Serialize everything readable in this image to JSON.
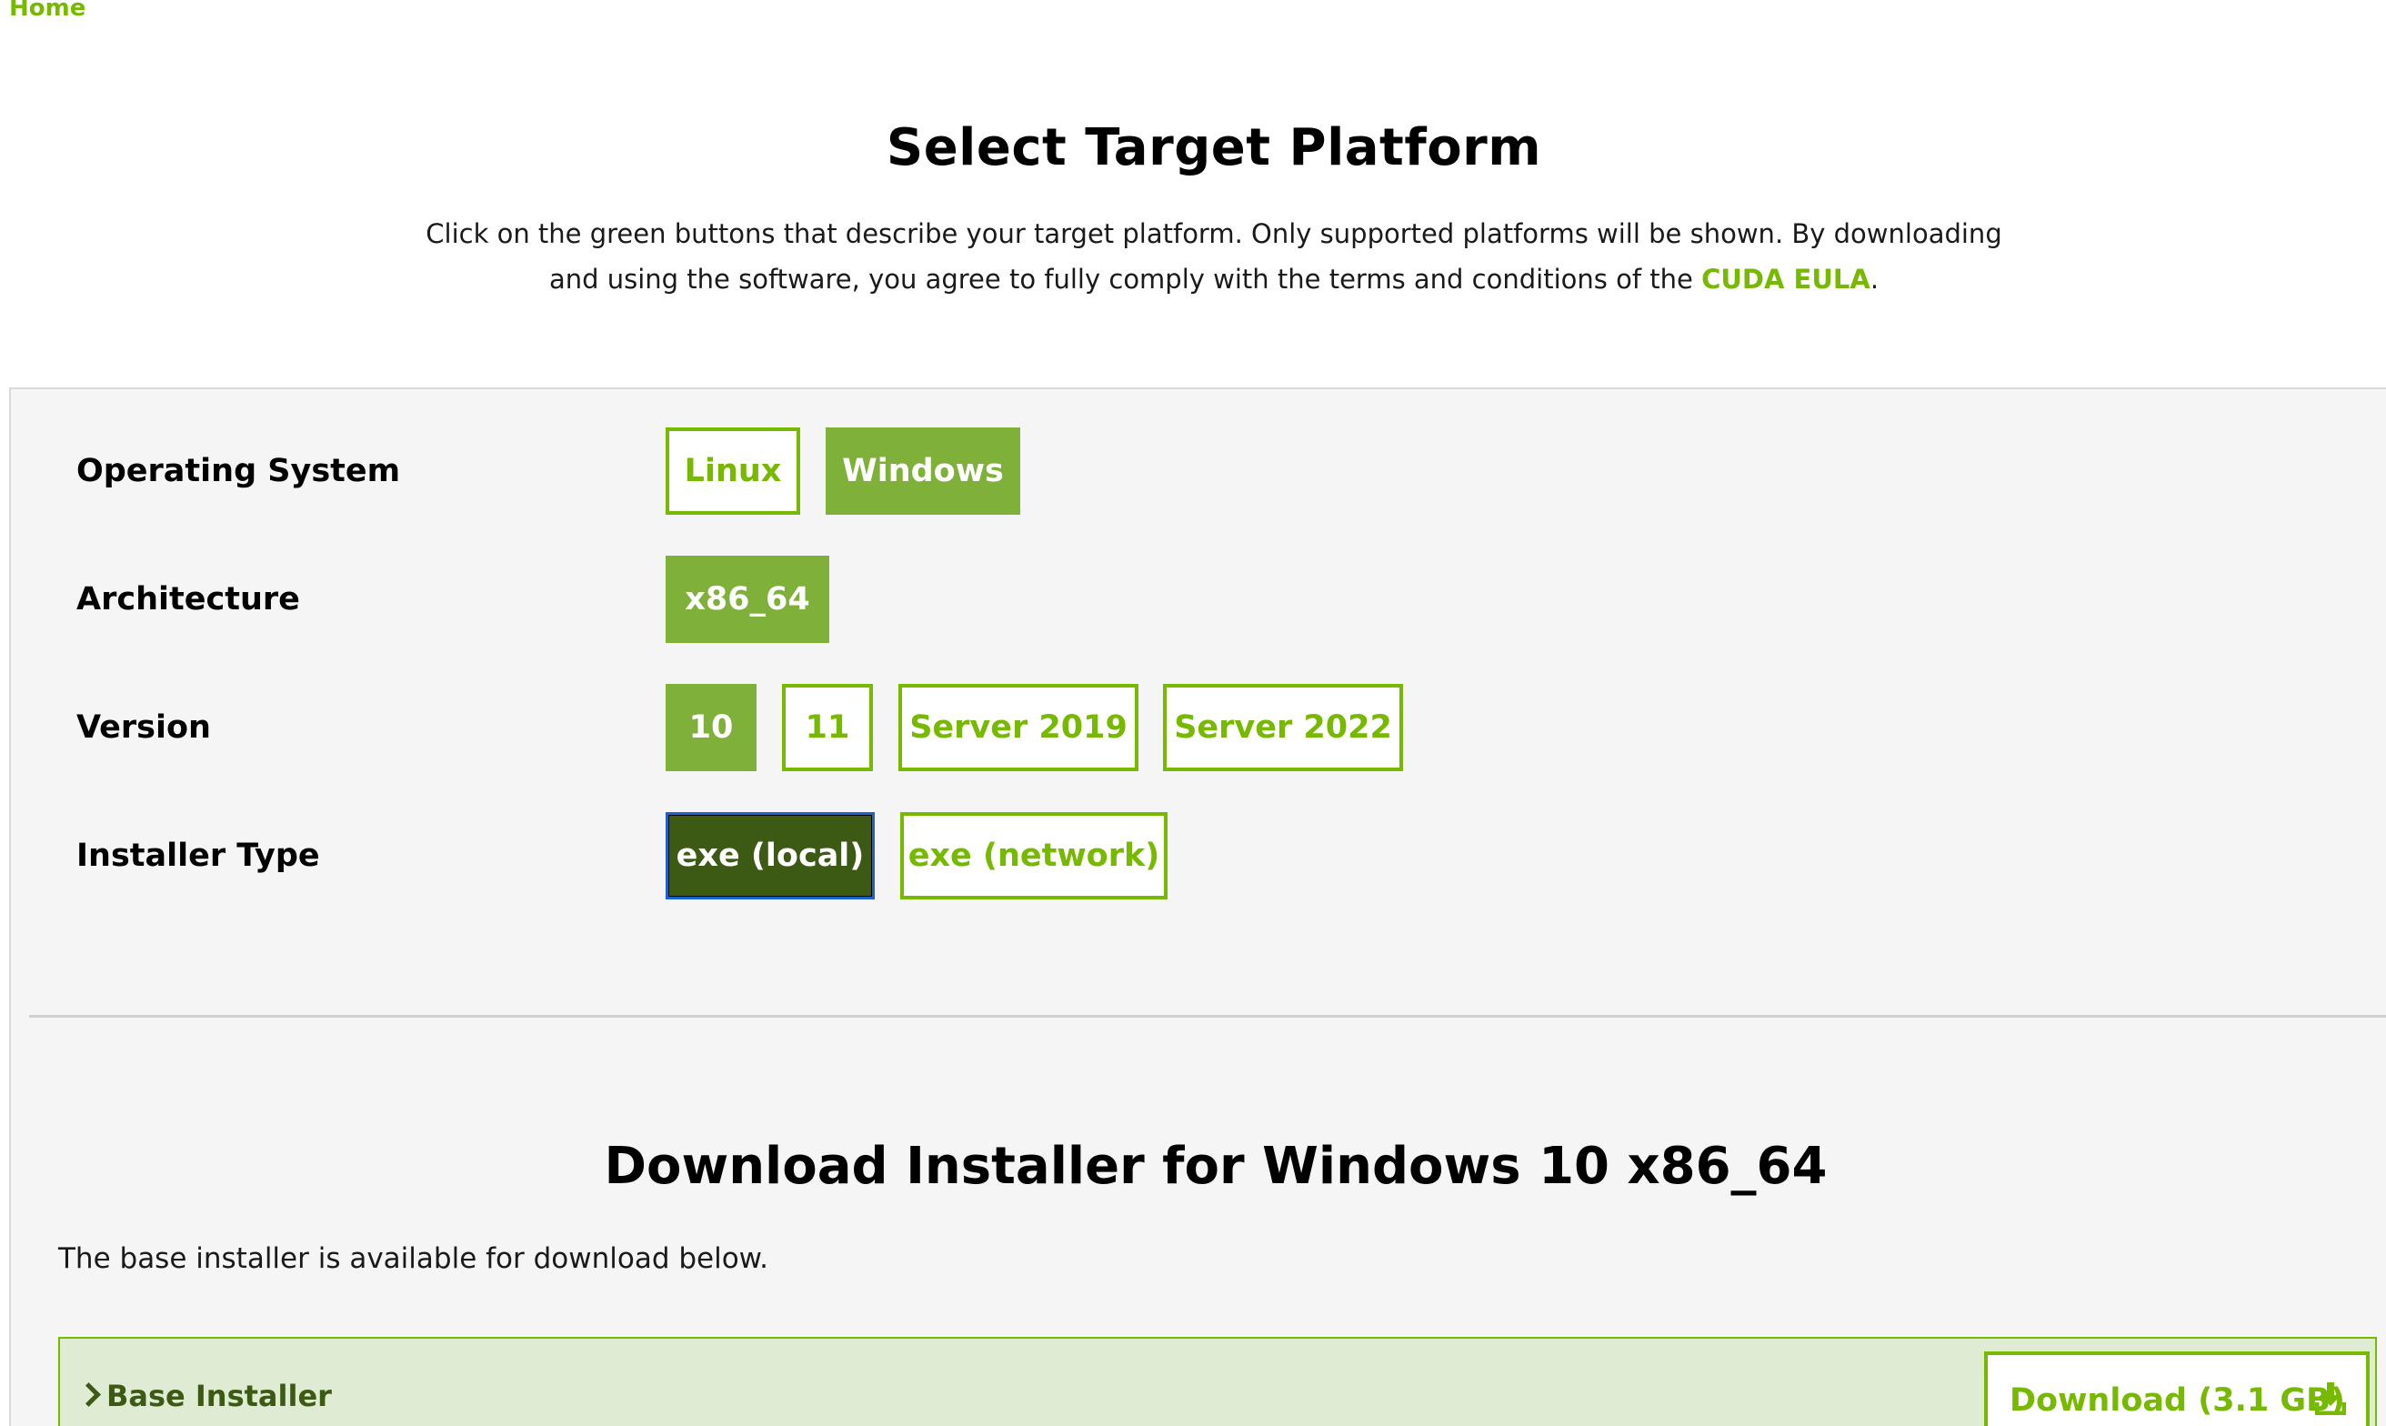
{
  "nav": {
    "home_label": "Home"
  },
  "header": {
    "title": "Select Target Platform",
    "intro_text": "Click on the green buttons that describe your target platform. Only supported platforms will be shown. By downloading and using the software, you agree to fully comply with the terms and conditions of the ",
    "eula_link": "CUDA EULA",
    "intro_suffix": "."
  },
  "selector": {
    "os": {
      "label": "Operating System",
      "options": [
        "Linux",
        "Windows"
      ],
      "selected": "Windows"
    },
    "architecture": {
      "label": "Architecture",
      "options": [
        "x86_64"
      ],
      "selected": "x86_64"
    },
    "version": {
      "label": "Version",
      "options": [
        "10",
        "11",
        "Server 2019",
        "Server 2022"
      ],
      "selected": "10"
    },
    "installer_type": {
      "label": "Installer Type",
      "options": [
        "exe (local)",
        "exe (network)"
      ],
      "selected": "exe (local)"
    }
  },
  "download": {
    "title": "Download Installer for Windows 10 x86_64",
    "description": "The base installer is available for download below.",
    "base_installer_label": "Base Installer",
    "download_button_label": "Download (3.1 GB)",
    "icons": {
      "toggle": "chevron-right-icon",
      "download": "download-icon"
    }
  },
  "colors": {
    "accent": "#76b900",
    "selected_fill": "#7fb03a",
    "active_fill": "#3d5a14",
    "panel_bg": "#f5f5f5",
    "installer_bg": "#dfebd3"
  }
}
